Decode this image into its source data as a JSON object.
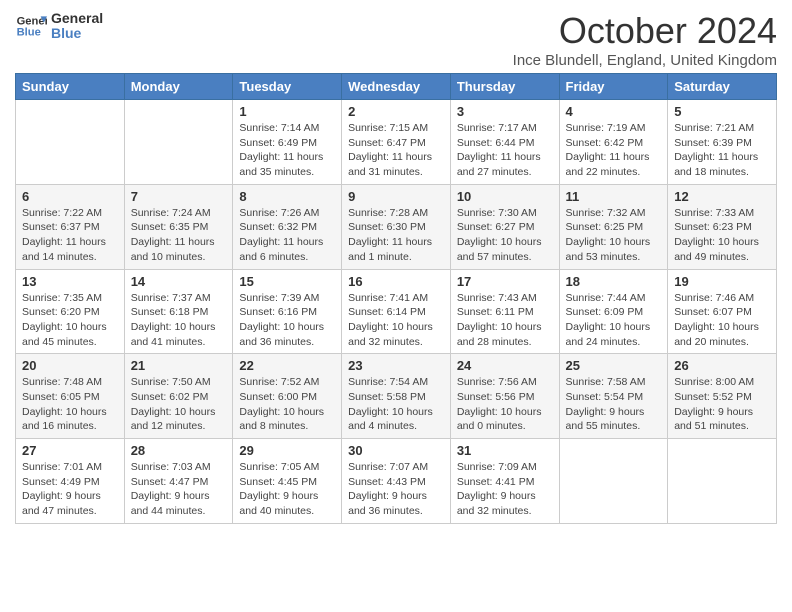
{
  "header": {
    "logo_line1": "General",
    "logo_line2": "Blue",
    "month_title": "October 2024",
    "location": "Ince Blundell, England, United Kingdom"
  },
  "days_of_week": [
    "Sunday",
    "Monday",
    "Tuesday",
    "Wednesday",
    "Thursday",
    "Friday",
    "Saturday"
  ],
  "weeks": [
    [
      {
        "day": "",
        "info": ""
      },
      {
        "day": "",
        "info": ""
      },
      {
        "day": "1",
        "info": "Sunrise: 7:14 AM\nSunset: 6:49 PM\nDaylight: 11 hours and 35 minutes."
      },
      {
        "day": "2",
        "info": "Sunrise: 7:15 AM\nSunset: 6:47 PM\nDaylight: 11 hours and 31 minutes."
      },
      {
        "day": "3",
        "info": "Sunrise: 7:17 AM\nSunset: 6:44 PM\nDaylight: 11 hours and 27 minutes."
      },
      {
        "day": "4",
        "info": "Sunrise: 7:19 AM\nSunset: 6:42 PM\nDaylight: 11 hours and 22 minutes."
      },
      {
        "day": "5",
        "info": "Sunrise: 7:21 AM\nSunset: 6:39 PM\nDaylight: 11 hours and 18 minutes."
      }
    ],
    [
      {
        "day": "6",
        "info": "Sunrise: 7:22 AM\nSunset: 6:37 PM\nDaylight: 11 hours and 14 minutes."
      },
      {
        "day": "7",
        "info": "Sunrise: 7:24 AM\nSunset: 6:35 PM\nDaylight: 11 hours and 10 minutes."
      },
      {
        "day": "8",
        "info": "Sunrise: 7:26 AM\nSunset: 6:32 PM\nDaylight: 11 hours and 6 minutes."
      },
      {
        "day": "9",
        "info": "Sunrise: 7:28 AM\nSunset: 6:30 PM\nDaylight: 11 hours and 1 minute."
      },
      {
        "day": "10",
        "info": "Sunrise: 7:30 AM\nSunset: 6:27 PM\nDaylight: 10 hours and 57 minutes."
      },
      {
        "day": "11",
        "info": "Sunrise: 7:32 AM\nSunset: 6:25 PM\nDaylight: 10 hours and 53 minutes."
      },
      {
        "day": "12",
        "info": "Sunrise: 7:33 AM\nSunset: 6:23 PM\nDaylight: 10 hours and 49 minutes."
      }
    ],
    [
      {
        "day": "13",
        "info": "Sunrise: 7:35 AM\nSunset: 6:20 PM\nDaylight: 10 hours and 45 minutes."
      },
      {
        "day": "14",
        "info": "Sunrise: 7:37 AM\nSunset: 6:18 PM\nDaylight: 10 hours and 41 minutes."
      },
      {
        "day": "15",
        "info": "Sunrise: 7:39 AM\nSunset: 6:16 PM\nDaylight: 10 hours and 36 minutes."
      },
      {
        "day": "16",
        "info": "Sunrise: 7:41 AM\nSunset: 6:14 PM\nDaylight: 10 hours and 32 minutes."
      },
      {
        "day": "17",
        "info": "Sunrise: 7:43 AM\nSunset: 6:11 PM\nDaylight: 10 hours and 28 minutes."
      },
      {
        "day": "18",
        "info": "Sunrise: 7:44 AM\nSunset: 6:09 PM\nDaylight: 10 hours and 24 minutes."
      },
      {
        "day": "19",
        "info": "Sunrise: 7:46 AM\nSunset: 6:07 PM\nDaylight: 10 hours and 20 minutes."
      }
    ],
    [
      {
        "day": "20",
        "info": "Sunrise: 7:48 AM\nSunset: 6:05 PM\nDaylight: 10 hours and 16 minutes."
      },
      {
        "day": "21",
        "info": "Sunrise: 7:50 AM\nSunset: 6:02 PM\nDaylight: 10 hours and 12 minutes."
      },
      {
        "day": "22",
        "info": "Sunrise: 7:52 AM\nSunset: 6:00 PM\nDaylight: 10 hours and 8 minutes."
      },
      {
        "day": "23",
        "info": "Sunrise: 7:54 AM\nSunset: 5:58 PM\nDaylight: 10 hours and 4 minutes."
      },
      {
        "day": "24",
        "info": "Sunrise: 7:56 AM\nSunset: 5:56 PM\nDaylight: 10 hours and 0 minutes."
      },
      {
        "day": "25",
        "info": "Sunrise: 7:58 AM\nSunset: 5:54 PM\nDaylight: 9 hours and 55 minutes."
      },
      {
        "day": "26",
        "info": "Sunrise: 8:00 AM\nSunset: 5:52 PM\nDaylight: 9 hours and 51 minutes."
      }
    ],
    [
      {
        "day": "27",
        "info": "Sunrise: 7:01 AM\nSunset: 4:49 PM\nDaylight: 9 hours and 47 minutes."
      },
      {
        "day": "28",
        "info": "Sunrise: 7:03 AM\nSunset: 4:47 PM\nDaylight: 9 hours and 44 minutes."
      },
      {
        "day": "29",
        "info": "Sunrise: 7:05 AM\nSunset: 4:45 PM\nDaylight: 9 hours and 40 minutes."
      },
      {
        "day": "30",
        "info": "Sunrise: 7:07 AM\nSunset: 4:43 PM\nDaylight: 9 hours and 36 minutes."
      },
      {
        "day": "31",
        "info": "Sunrise: 7:09 AM\nSunset: 4:41 PM\nDaylight: 9 hours and 32 minutes."
      },
      {
        "day": "",
        "info": ""
      },
      {
        "day": "",
        "info": ""
      }
    ]
  ]
}
